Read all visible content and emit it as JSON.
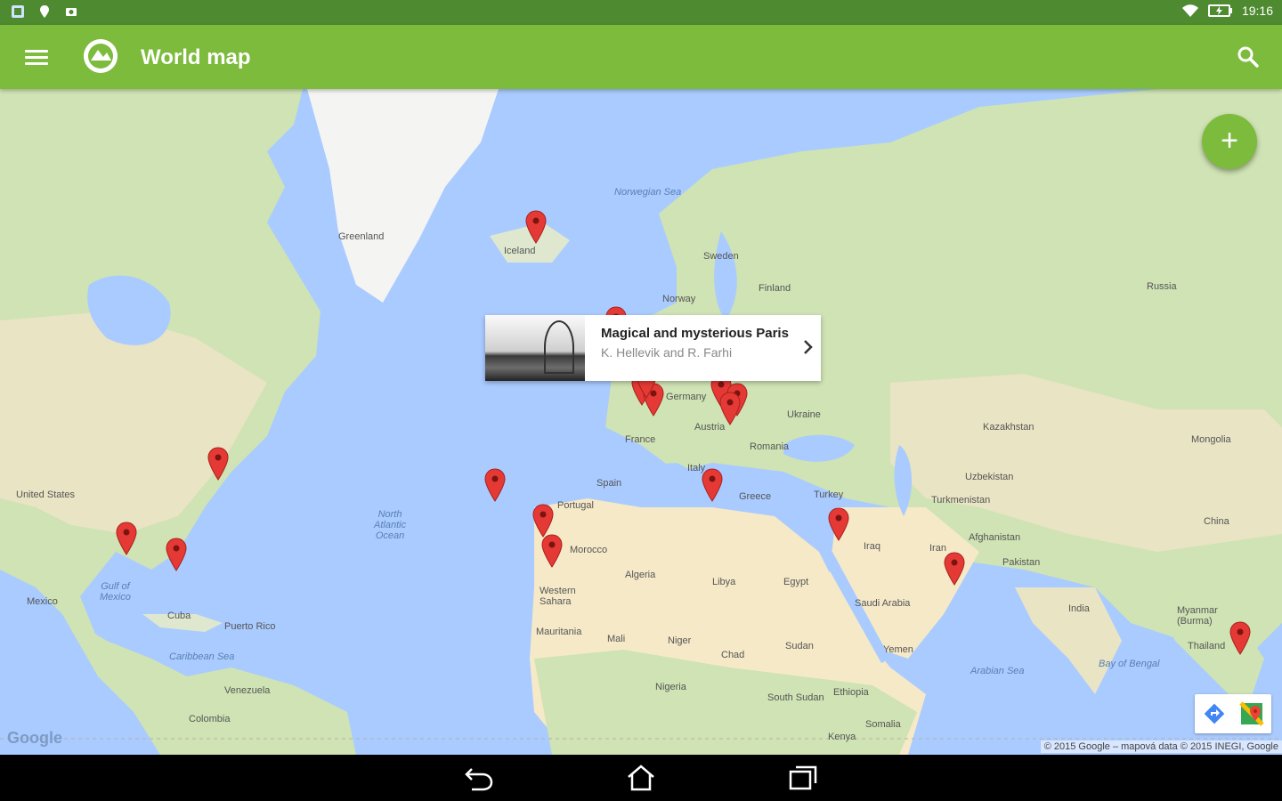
{
  "status_bar": {
    "time": "19:16",
    "icons": [
      "notification-app-icon",
      "location-icon",
      "photo-icon",
      "wifi-icon",
      "battery-icon"
    ]
  },
  "app_bar": {
    "title": "World map",
    "color": "#7cbb3b",
    "icons": [
      "menu-icon",
      "app-logo-icon",
      "search-icon"
    ]
  },
  "fab": {
    "label": "+",
    "icon": "add-icon"
  },
  "info_window": {
    "title": "Magical and mysterious Paris",
    "subtitle": "K. Hellevik and R. Farhi",
    "icon": "chevron-right-icon"
  },
  "map": {
    "labels": {
      "greenland": "Greenland",
      "iceland": "Iceland",
      "norwegian_sea": "Norwegian Sea",
      "sweden": "Sweden",
      "finland": "Finland",
      "norway": "Norway",
      "russia": "Russia",
      "germany": "Germany",
      "ukraine": "Ukraine",
      "kazakhstan": "Kazakhstan",
      "mongolia": "Mongolia",
      "france": "France",
      "austria": "Austria",
      "romania": "Romania",
      "spain": "Spain",
      "portugal": "Portugal",
      "italy": "Italy",
      "greece": "Greece",
      "turkey": "Turkey",
      "uzbekistan": "Uzbekistan",
      "turkmenistan": "Turkmenistan",
      "china": "China",
      "afghanistan": "Afghanistan",
      "iran": "Iran",
      "iraq": "Iraq",
      "pakistan": "Pakistan",
      "united_states": "United States",
      "north_atlantic": "North\nAtlantic\nOcean",
      "morocco": "Morocco",
      "algeria": "Algeria",
      "libya": "Libya",
      "egypt": "Egypt",
      "saudi_arabia": "Saudi Arabia",
      "india": "India",
      "mexico": "Mexico",
      "gulf_of_mexico": "Gulf of\nMexico",
      "cuba": "Cuba",
      "puerto_rico": "Puerto Rico",
      "caribbean_sea": "Caribbean Sea",
      "western_sahara": "Western\nSahara",
      "mauritania": "Mauritania",
      "mali": "Mali",
      "niger": "Niger",
      "chad": "Chad",
      "sudan": "Sudan",
      "yemen": "Yemen",
      "arabian_sea": "Arabian Sea",
      "bay_of_bengal": "Bay of Bengal",
      "myanmar": "Myanmar\n(Burma)",
      "thailand": "Thailand",
      "venezuela": "Venezuela",
      "colombia": "Colombia",
      "nigeria": "Nigeria",
      "ethiopia": "Ethiopia",
      "south_sudan": "South Sudan",
      "somalia": "Somalia",
      "kenya": "Kenya"
    },
    "marker_count": 18,
    "marker_color": "#e53935"
  },
  "map_tools": [
    "directions-icon",
    "google-maps-icon"
  ],
  "attribution": {
    "logo": "Google",
    "copyright": "© 2015 Google – mapová data © 2015 INEGI, Google"
  },
  "nav_bar": {
    "icons": [
      "back-icon",
      "home-icon",
      "recent-apps-icon"
    ]
  }
}
